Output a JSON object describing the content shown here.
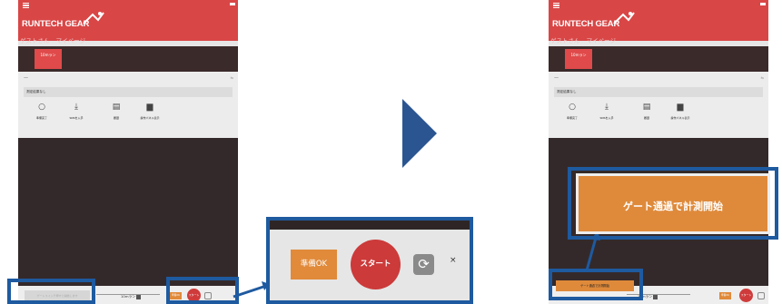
{
  "app": {
    "logo_text": "RUNTECH GEAR",
    "user_name": "ゲストさん",
    "mypage_label": "マイページ",
    "tab_label": "10mラン",
    "panel_label": "—",
    "result_text": "測定結果なし",
    "icons": [
      {
        "icon": "circle-icon",
        "glyph": "○",
        "label": "準備完了"
      },
      {
        "icon": "download-icon",
        "glyph": "⤓",
        "label": "SNSを入手"
      },
      {
        "icon": "clipboard-icon",
        "glyph": "▤",
        "label": "履歴"
      },
      {
        "icon": "device-icon",
        "glyph": "▆",
        "label": "操作パネル表示"
      }
    ],
    "bottom_hint": "ゲートスイッチ押すと開始します",
    "dropdown_value": "10mラン",
    "ready_label": "準備OK",
    "start_label": "スタート"
  },
  "zoom": {
    "ready_label": "準備OK",
    "start_label": "スタート",
    "sync_glyph": "⟳",
    "close_label": "×"
  },
  "right_screen": {
    "gate_button_label": "ゲート通過で計測開始",
    "gate_small_label": "ゲート通過で計測開始"
  },
  "colors": {
    "header_red": "#d94646",
    "orange": "#df8a3b",
    "start_red": "#cc3a3a",
    "highlight_blue": "#1e5a9f",
    "dark_brown": "#34292a"
  }
}
